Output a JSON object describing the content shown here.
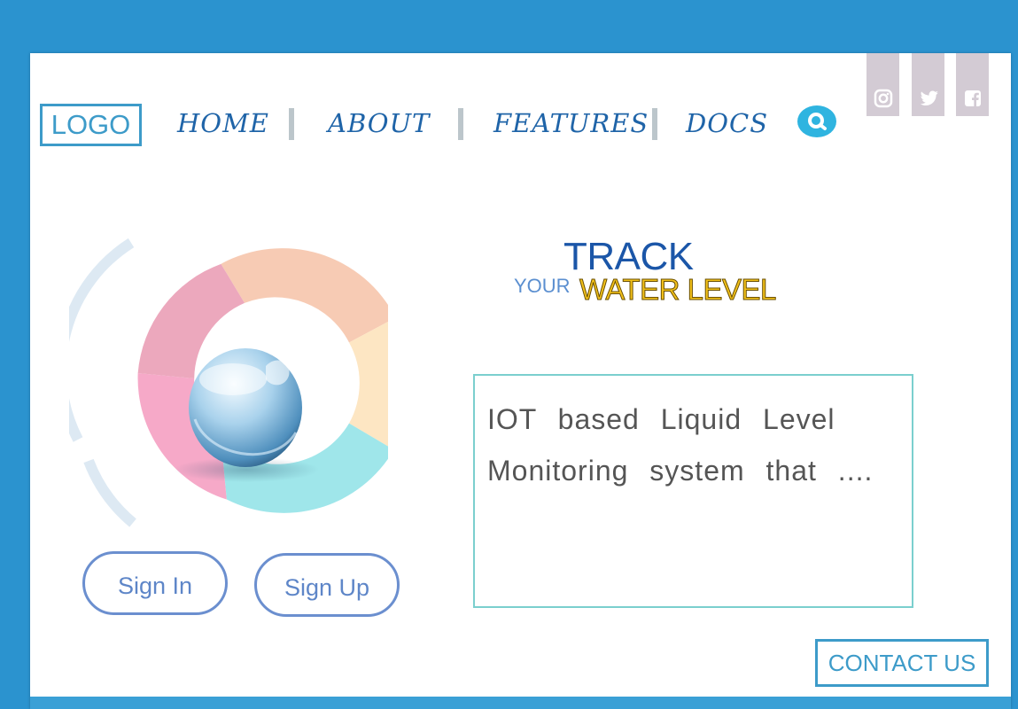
{
  "header": {
    "logo": "LOGO",
    "nav": [
      "HOME",
      "ABOUT",
      "FEATURES",
      "DOCS"
    ]
  },
  "social": [
    "instagram-icon",
    "twitter-icon",
    "facebook-icon"
  ],
  "hero": {
    "track": "TRACK",
    "your": "YOUR",
    "water_level": "WATER LEVEL"
  },
  "auth": {
    "sign_in": "Sign In",
    "sign_up": "Sign Up"
  },
  "description": "IOT based Liquid Level Monitoring system that ....",
  "footer": {
    "contact": "CONTACT US"
  },
  "colors": {
    "background": "#2b93cf",
    "accent": "#3d9bc9",
    "title_blue": "#1b56a8",
    "water_yellow": "#f3c21a"
  }
}
